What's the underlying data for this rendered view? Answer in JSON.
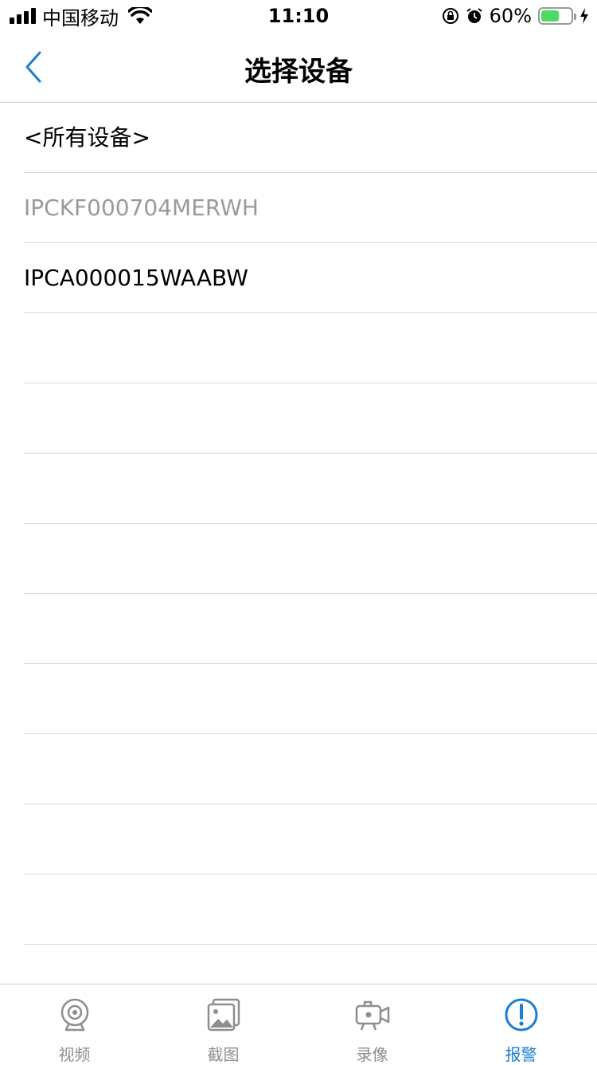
{
  "status_bar": {
    "carrier": "中国移动",
    "time": "11:10",
    "battery": "60%",
    "battery_level": 0.6
  },
  "nav": {
    "title": "选择设备",
    "back_icon": "chevron-left-icon"
  },
  "devices": [
    {
      "label": "<所有设备>",
      "enabled": true
    },
    {
      "label": "IPCKF000704MERWH",
      "enabled": false
    },
    {
      "label": "IPCA000015WAABW",
      "enabled": true
    },
    {
      "label": "",
      "enabled": true
    },
    {
      "label": "",
      "enabled": true
    },
    {
      "label": "",
      "enabled": true
    },
    {
      "label": "",
      "enabled": true
    },
    {
      "label": "",
      "enabled": true
    },
    {
      "label": "",
      "enabled": true
    },
    {
      "label": "",
      "enabled": true
    },
    {
      "label": "",
      "enabled": true
    },
    {
      "label": "",
      "enabled": true
    },
    {
      "label": "",
      "enabled": true
    }
  ],
  "tabs": [
    {
      "label": "视频",
      "icon": "webcam-icon",
      "active": false
    },
    {
      "label": "截图",
      "icon": "image-icon",
      "active": false
    },
    {
      "label": "录像",
      "icon": "video-camera-icon",
      "active": false
    },
    {
      "label": "报警",
      "icon": "alert-icon",
      "active": true
    }
  ],
  "colors": {
    "accent": "#1a7fd4",
    "inactive": "#8e8e8e",
    "disabled_text": "#9a9a9a",
    "battery": "#4cd964"
  }
}
